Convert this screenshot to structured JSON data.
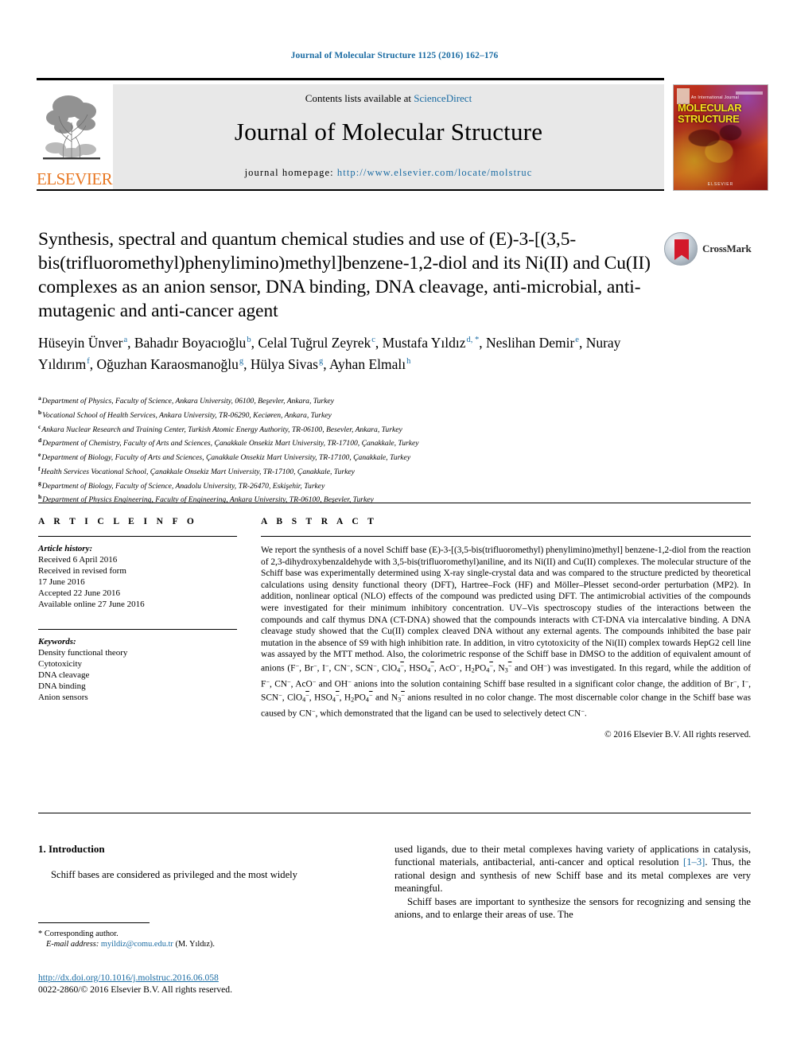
{
  "running_head": "Journal of Molecular Structure 1125 (2016) 162–176",
  "masthead": {
    "contents_prefix": "Contents lists available at ",
    "sciencedirect": "ScienceDirect",
    "journal_title": "Journal of Molecular Structure",
    "homepage_prefix": "journal homepage: ",
    "homepage_url": "http://www.elsevier.com/locate/molstruc",
    "publisher_name": "ELSEVIER",
    "cover": {
      "preline": "An International Journal",
      "title_line1": "MOLECULAR",
      "title_line2": "STRUCTURE",
      "footer": "ELSEVIER"
    }
  },
  "crossmark": {
    "label": "CrossMark"
  },
  "title": "Synthesis, spectral and quantum chemical studies and use of (E)-3-[(3,5-bis(trifluoromethyl)phenylimino)methyl]benzene-1,2-diol and its Ni(II) and Cu(II) complexes as an anion sensor, DNA binding, DNA cleavage, anti-microbial, anti-mutagenic and anti-cancer agent",
  "authors": [
    {
      "name": "Hüseyin Ünver",
      "marks": "a"
    },
    {
      "name": "Bahadır Boyacıoğlu",
      "marks": "b"
    },
    {
      "name": "Celal Tuğrul Zeyrek",
      "marks": "c"
    },
    {
      "name": "Mustafa Yıldız",
      "marks": "d, *"
    },
    {
      "name": "Neslihan Demir",
      "marks": "e"
    },
    {
      "name": "Nuray Yıldırım",
      "marks": "f"
    },
    {
      "name": "Oğuzhan Karaosmanoğlu",
      "marks": "g"
    },
    {
      "name": "Hülya Sivas",
      "marks": "g"
    },
    {
      "name": "Ayhan Elmalı",
      "marks": "h"
    }
  ],
  "affiliations": [
    {
      "mark": "a",
      "text": "Department of Physics, Faculty of Science, Ankara University, 06100, Beşevler, Ankara, Turkey"
    },
    {
      "mark": "b",
      "text": "Vocational School of Health Services, Ankara University, TR-06290, Keciøren, Ankara, Turkey"
    },
    {
      "mark": "c",
      "text": "Ankara Nuclear Research and Training Center, Turkish Atomic Energy Authority, TR-06100, Besevler, Ankara, Turkey"
    },
    {
      "mark": "d",
      "text": "Department of Chemistry, Faculty of Arts and Sciences, Çanakkale Onsekiz Mart University, TR-17100, Çanakkale, Turkey"
    },
    {
      "mark": "e",
      "text": "Department of Biology, Faculty of Arts and Sciences, Çanakkale Onsekiz Mart University, TR-17100, Çanakkale, Turkey"
    },
    {
      "mark": "f",
      "text": "Health Services Vocational School, Çanakkale Onsekiz Mart University, TR-17100, Çanakkale, Turkey"
    },
    {
      "mark": "g",
      "text": "Department of Biology, Faculty of Science, Anadolu University, TR-26470, Eskişehir, Turkey"
    },
    {
      "mark": "h",
      "text": "Department of Physics Engineering, Faculty of Engineering, Ankara University, TR-06100, Beşevler, Turkey"
    }
  ],
  "article_info": {
    "heading": "A R T I C L E   I N F O",
    "history_label": "Article history:",
    "history": [
      "Received 6 April 2016",
      "Received in revised form",
      "17 June 2016",
      "Accepted 22 June 2016",
      "Available online 27 June 2016"
    ],
    "keywords_label": "Keywords:",
    "keywords": [
      "Density functional theory",
      "Cytotoxicity",
      "DNA cleavage",
      "DNA binding",
      "Anion sensors"
    ]
  },
  "abstract": {
    "heading": "A B S T R A C T",
    "copyright": "© 2016 Elsevier B.V. All rights reserved."
  },
  "introduction": {
    "number_title": "1. Introduction",
    "left_par1": "Schiff bases are considered as privileged and the most widely",
    "right_par1_a": "used ligands, due to their metal complexes having variety of applications in catalysis, functional materials, antibacterial, anti-cancer and optical resolution ",
    "right_ref": "[1–3]",
    "right_par1_b": ". Thus, the rational design and synthesis of new Schiff base and its metal complexes are very meaningful.",
    "right_par2": "Schiff bases are important to synthesize the sensors for recognizing and sensing the anions, and to enlarge their areas of use. The"
  },
  "footnote": {
    "star": "*",
    "corresponding": "Corresponding author.",
    "email_label": "E-mail address:",
    "email": "myildiz@comu.edu.tr",
    "email_suffix": "(M. Yıldız)."
  },
  "doi_block": {
    "doi": "http://dx.doi.org/10.1016/j.molstruc.2016.06.058",
    "issn_line": "0022-2860/© 2016 Elsevier B.V. All rights reserved."
  },
  "colors": {
    "link_blue": "#1b6ca3",
    "elsevier_orange": "#E87722",
    "band_gray": "#e8e8e8"
  }
}
